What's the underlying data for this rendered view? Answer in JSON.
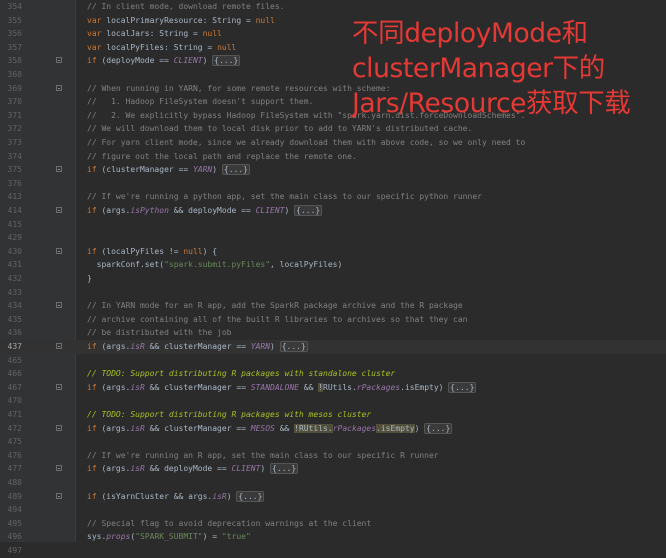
{
  "annotation": {
    "lines": [
      "不同deployMode和",
      "clusterManager下的",
      "Jars/Resource获取下载"
    ],
    "color": "#e53935"
  },
  "current_line": "437",
  "lines": [
    {
      "num": "354",
      "fold": false,
      "tokens": [
        {
          "t": "// In client mode, download remote files.",
          "c": "comment"
        }
      ]
    },
    {
      "num": "355",
      "fold": false,
      "tokens": [
        {
          "t": "var ",
          "c": "kw"
        },
        {
          "t": "localPrimaryResource: ",
          "c": "plain"
        },
        {
          "t": "String",
          "c": "plain"
        },
        {
          "t": " = ",
          "c": "plain"
        },
        {
          "t": "null",
          "c": "kw"
        }
      ]
    },
    {
      "num": "356",
      "fold": false,
      "tokens": [
        {
          "t": "var ",
          "c": "kw"
        },
        {
          "t": "localJars: ",
          "c": "plain"
        },
        {
          "t": "String",
          "c": "plain"
        },
        {
          "t": " = ",
          "c": "plain"
        },
        {
          "t": "null",
          "c": "kw"
        }
      ]
    },
    {
      "num": "357",
      "fold": false,
      "tokens": [
        {
          "t": "var ",
          "c": "kw"
        },
        {
          "t": "localPyFiles: ",
          "c": "plain"
        },
        {
          "t": "String",
          "c": "plain"
        },
        {
          "t": " = ",
          "c": "plain"
        },
        {
          "t": "null",
          "c": "kw"
        }
      ]
    },
    {
      "num": "358",
      "fold": true,
      "tokens": [
        {
          "t": "if ",
          "c": "kw"
        },
        {
          "t": "(deployMode == ",
          "c": "plain"
        },
        {
          "t": "CLIENT",
          "c": "ital"
        },
        {
          "t": ") ",
          "c": "plain"
        },
        {
          "t": "{...}",
          "c": "folded"
        }
      ]
    },
    {
      "num": "368",
      "fold": false,
      "tokens": []
    },
    {
      "num": "369",
      "fold": true,
      "tokens": [
        {
          "t": "// When running in YARN, for some remote resources with scheme:",
          "c": "comment"
        }
      ]
    },
    {
      "num": "370",
      "fold": false,
      "tokens": [
        {
          "t": "//   1. Hadoop FileSystem doesn't support them.",
          "c": "comment"
        }
      ]
    },
    {
      "num": "371",
      "fold": false,
      "tokens": [
        {
          "t": "//   2. We explicitly bypass Hadoop FileSystem with \"spark.yarn.dist.forceDownloadSchemes\".",
          "c": "comment"
        }
      ]
    },
    {
      "num": "372",
      "fold": false,
      "tokens": [
        {
          "t": "// We will download them to local disk prior to add to YARN's distributed cache.",
          "c": "comment"
        }
      ]
    },
    {
      "num": "373",
      "fold": false,
      "tokens": [
        {
          "t": "// For yarn client mode, since we already download them with above code, so we only need to",
          "c": "comment"
        }
      ]
    },
    {
      "num": "374",
      "fold": false,
      "tokens": [
        {
          "t": "// figure out the local path and replace the remote one.",
          "c": "comment"
        }
      ]
    },
    {
      "num": "375",
      "fold": true,
      "tokens": [
        {
          "t": "if ",
          "c": "kw"
        },
        {
          "t": "(clusterManager == ",
          "c": "plain"
        },
        {
          "t": "YARN",
          "c": "ital"
        },
        {
          "t": ") ",
          "c": "plain"
        },
        {
          "t": "{...}",
          "c": "folded"
        }
      ]
    },
    {
      "num": "376",
      "fold": false,
      "tokens": []
    },
    {
      "num": "413",
      "fold": false,
      "tokens": [
        {
          "t": "// If we're running a python app, set the main class to our specific python runner",
          "c": "comment"
        }
      ]
    },
    {
      "num": "414",
      "fold": true,
      "tokens": [
        {
          "t": "if ",
          "c": "kw"
        },
        {
          "t": "(args.",
          "c": "plain"
        },
        {
          "t": "isPython",
          "c": "ital"
        },
        {
          "t": " && deployMode == ",
          "c": "plain"
        },
        {
          "t": "CLIENT",
          "c": "ital"
        },
        {
          "t": ") ",
          "c": "plain"
        },
        {
          "t": "{...}",
          "c": "folded"
        }
      ]
    },
    {
      "num": "415",
      "fold": false,
      "tokens": []
    },
    {
      "num": "429",
      "fold": false,
      "tokens": []
    },
    {
      "num": "430",
      "fold": true,
      "tokens": [
        {
          "t": "if ",
          "c": "kw"
        },
        {
          "t": "(localPyFiles != ",
          "c": "plain"
        },
        {
          "t": "null",
          "c": "kw"
        },
        {
          "t": ") {",
          "c": "plain"
        }
      ]
    },
    {
      "num": "431",
      "fold": false,
      "tokens": [
        {
          "t": "  sparkConf.set(",
          "c": "plain"
        },
        {
          "t": "\"spark.submit.pyFiles\"",
          "c": "str"
        },
        {
          "t": ", localPyFiles)",
          "c": "plain"
        }
      ]
    },
    {
      "num": "432",
      "fold": false,
      "tokens": [
        {
          "t": "}",
          "c": "plain"
        }
      ]
    },
    {
      "num": "433",
      "fold": false,
      "tokens": []
    },
    {
      "num": "434",
      "fold": true,
      "tokens": [
        {
          "t": "// In YARN mode for an R app, add the SparkR package archive and the R package",
          "c": "comment"
        }
      ]
    },
    {
      "num": "435",
      "fold": false,
      "tokens": [
        {
          "t": "// archive containing all of the built R libraries to archives so that they can",
          "c": "comment"
        }
      ]
    },
    {
      "num": "436",
      "fold": false,
      "tokens": [
        {
          "t": "// be distributed with the job",
          "c": "comment"
        }
      ]
    },
    {
      "num": "437",
      "fold": true,
      "tokens": [
        {
          "t": "if ",
          "c": "kw"
        },
        {
          "t": "(args.",
          "c": "plain"
        },
        {
          "t": "isR",
          "c": "ital"
        },
        {
          "t": " && clusterManager == ",
          "c": "plain"
        },
        {
          "t": "YARN",
          "c": "ital"
        },
        {
          "t": ") ",
          "c": "plain"
        },
        {
          "t": "{...}",
          "c": "folded"
        }
      ]
    },
    {
      "num": "465",
      "fold": false,
      "tokens": []
    },
    {
      "num": "466",
      "fold": false,
      "tokens": [
        {
          "t": "// TODO: Support distributing R packages with standalone cluster",
          "c": "todo"
        }
      ]
    },
    {
      "num": "467",
      "fold": true,
      "tokens": [
        {
          "t": "if ",
          "c": "kw"
        },
        {
          "t": "(args.",
          "c": "plain"
        },
        {
          "t": "isR",
          "c": "ital"
        },
        {
          "t": " && clusterManager == ",
          "c": "plain"
        },
        {
          "t": "STANDALONE",
          "c": "ital"
        },
        {
          "t": " && ",
          "c": "plain"
        },
        {
          "t": "!",
          "c": "warnmark"
        },
        {
          "t": "RUtils.",
          "c": "plain"
        },
        {
          "t": "rPackages",
          "c": "ital"
        },
        {
          "t": ".isEmpty",
          "c": "plain"
        },
        {
          "t": ") ",
          "c": "plain"
        },
        {
          "t": "{...}",
          "c": "folded"
        }
      ]
    },
    {
      "num": "470",
      "fold": false,
      "tokens": []
    },
    {
      "num": "471",
      "fold": false,
      "tokens": [
        {
          "t": "// TODO: Support distributing R packages with mesos cluster",
          "c": "todo"
        }
      ]
    },
    {
      "num": "472",
      "fold": true,
      "tokens": [
        {
          "t": "if ",
          "c": "kw"
        },
        {
          "t": "(args.",
          "c": "plain"
        },
        {
          "t": "isR",
          "c": "ital"
        },
        {
          "t": " && clusterManager == ",
          "c": "plain"
        },
        {
          "t": "MESOS",
          "c": "ital"
        },
        {
          "t": " && ",
          "c": "plain"
        },
        {
          "t": "!",
          "c": "warnmark"
        },
        {
          "t": "RUtils.",
          "c": "warn"
        },
        {
          "t": "rPackages",
          "c": "ital"
        },
        {
          "t": ".isEmpty",
          "c": "warn"
        },
        {
          "t": ") ",
          "c": "plain"
        },
        {
          "t": "{...}",
          "c": "folded"
        }
      ]
    },
    {
      "num": "475",
      "fold": false,
      "tokens": []
    },
    {
      "num": "476",
      "fold": false,
      "tokens": [
        {
          "t": "// If we're running an R app, set the main class to our specific R runner",
          "c": "comment"
        }
      ]
    },
    {
      "num": "477",
      "fold": true,
      "tokens": [
        {
          "t": "if ",
          "c": "kw"
        },
        {
          "t": "(args.",
          "c": "plain"
        },
        {
          "t": "isR",
          "c": "ital"
        },
        {
          "t": " && deployMode == ",
          "c": "plain"
        },
        {
          "t": "CLIENT",
          "c": "ital"
        },
        {
          "t": ") ",
          "c": "plain"
        },
        {
          "t": "{...}",
          "c": "folded"
        }
      ]
    },
    {
      "num": "488",
      "fold": false,
      "tokens": []
    },
    {
      "num": "489",
      "fold": true,
      "tokens": [
        {
          "t": "if ",
          "c": "kw"
        },
        {
          "t": "(isYarnCluster && args.",
          "c": "plain"
        },
        {
          "t": "isR",
          "c": "ital"
        },
        {
          "t": ") ",
          "c": "plain"
        },
        {
          "t": "{...}",
          "c": "folded"
        }
      ]
    },
    {
      "num": "494",
      "fold": false,
      "tokens": []
    },
    {
      "num": "495",
      "fold": false,
      "tokens": [
        {
          "t": "// Special flag to avoid deprecation warnings at the client",
          "c": "comment"
        }
      ]
    },
    {
      "num": "496",
      "fold": false,
      "tokens": [
        {
          "t": "sys.",
          "c": "plain"
        },
        {
          "t": "props",
          "c": "ital"
        },
        {
          "t": "(",
          "c": "plain"
        },
        {
          "t": "\"SPARK_SUBMIT\"",
          "c": "str"
        },
        {
          "t": ") = ",
          "c": "plain"
        },
        {
          "t": "\"true\"",
          "c": "str"
        }
      ]
    },
    {
      "num": "497",
      "fold": false,
      "tokens": []
    }
  ]
}
